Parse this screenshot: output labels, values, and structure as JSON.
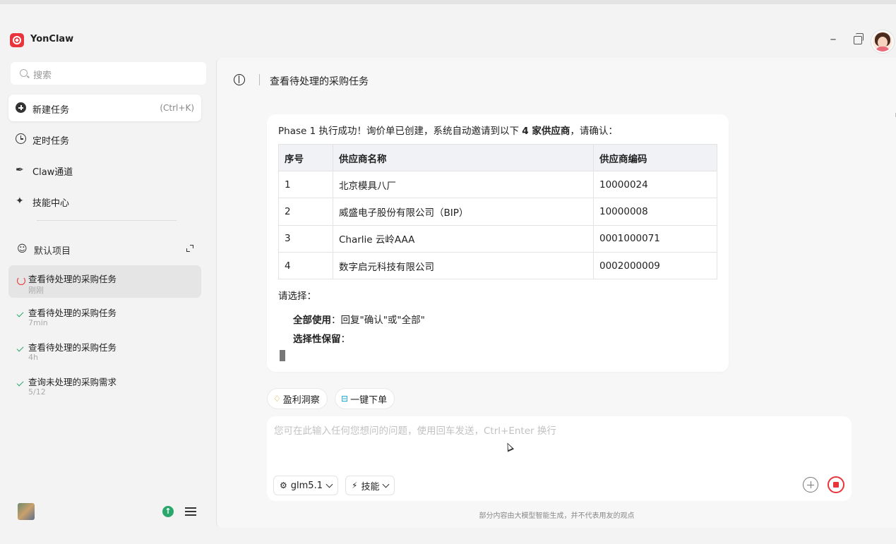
{
  "app": {
    "title": "YonClaw"
  },
  "colors": {
    "accent": "#e8343a",
    "success": "#2aa76c"
  },
  "sidebar": {
    "search_placeholder": "搜索",
    "nav": [
      {
        "label": "新建任务",
        "shortcut": "(Ctrl+K)",
        "icon": "plus-circle-icon"
      },
      {
        "label": "定时任务",
        "icon": "alarm-clock-icon"
      },
      {
        "label": "Claw通道",
        "icon": "claw-channel-icon"
      },
      {
        "label": "技能中心",
        "icon": "skill-center-icon"
      }
    ],
    "project": {
      "label": "默认项目",
      "icon": "user-add-icon"
    },
    "tasks": [
      {
        "title": "查看待处理的采购任务",
        "time": "刚刚",
        "status": "running"
      },
      {
        "title": "查看待处理的采购任务",
        "time": "7min",
        "status": "done"
      },
      {
        "title": "查看待处理的采购任务",
        "time": "4h",
        "status": "done"
      },
      {
        "title": "查询未处理的采购需求",
        "time": "5/12",
        "status": "done"
      }
    ]
  },
  "main": {
    "title": "查看待处理的采购任务",
    "message": {
      "intro_pre": "Phase 1 执行成功！询价单已创建，系统自动邀请到以下 ",
      "intro_bold": "4 家供应商",
      "intro_post": "，请确认：",
      "table": {
        "headers": [
          "序号",
          "供应商名称",
          "供应商编码"
        ],
        "rows": [
          [
            "1",
            "北京模具八厂",
            "10000024"
          ],
          [
            "2",
            "威盛电子股份有限公司（BIP）",
            "10000008"
          ],
          [
            "3",
            "Charlie 云岭AAA",
            "0001000071"
          ],
          [
            "4",
            "数字启元科技有限公司",
            "0002000009"
          ]
        ]
      },
      "choose_label": "请选择：",
      "option1_bold": "全部使用",
      "option1_text": "：回复\"确认\"或\"全部\"",
      "option2_bold": "选择性保留",
      "option2_text": "："
    },
    "chips": [
      {
        "label": "盈利洞察",
        "icon": "profit-insight-icon"
      },
      {
        "label": "一键下单",
        "icon": "one-click-order-icon"
      }
    ],
    "input": {
      "placeholder": "您可在此输入任何您想问的问题，使用回车发送，Ctrl+Enter 换行",
      "model": "glm5.1",
      "skills": "技能"
    },
    "footer_note": "部分内容由大模型智能生成，并不代表用友的观点"
  }
}
